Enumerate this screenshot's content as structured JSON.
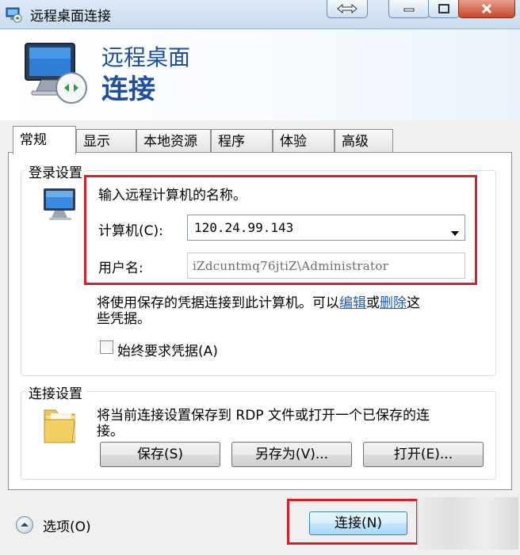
{
  "window": {
    "title": "远程桌面连接",
    "controls": {
      "restore_glyph": "⇔"
    }
  },
  "banner": {
    "line1": "远程桌面",
    "line2": "连接"
  },
  "tabs": [
    "常规",
    "显示",
    "本地资源",
    "程序",
    "体验",
    "高级"
  ],
  "login_group": {
    "title": "登录设置",
    "prompt": "输入远程计算机的名称。",
    "computer_label": "计算机(C):",
    "computer_value": "120.24.99.143",
    "username_label": "用户名:",
    "username_value": "iZdcuntmq76jtiZ\\Administrator",
    "saved_line1_pre": "将使用保存的凭据连接到此计算机。可以",
    "saved_edit_link": "编辑",
    "saved_or": "或",
    "saved_delete_link": "删除",
    "saved_line1_post": "这",
    "saved_line2": "些凭据。",
    "always_ask_label": "始终要求凭据(A)",
    "always_ask_checked": false
  },
  "connection_group": {
    "title": "连接设置",
    "description_line1": "将当前连接设置保存到 RDP 文件或打开一个已保存的连",
    "description_line2": "接。",
    "save_button": "保存(S)",
    "save_as_button": "另存为(V)...",
    "open_button": "打开(E)..."
  },
  "footer": {
    "options_label": "选项(O)",
    "connect_button": "连接(N)"
  },
  "colors": {
    "highlight_red": "#d8202a",
    "link_blue": "#1a5bc4",
    "banner_text": "#1f4e9c"
  },
  "icons": [
    "rdp-app-icon",
    "restore-icon",
    "minimize-icon",
    "maximize-icon",
    "close-icon",
    "remote-monitor-icon",
    "computer-icon",
    "folder-icon",
    "options-expand-icon",
    "dropdown-arrow-icon"
  ]
}
